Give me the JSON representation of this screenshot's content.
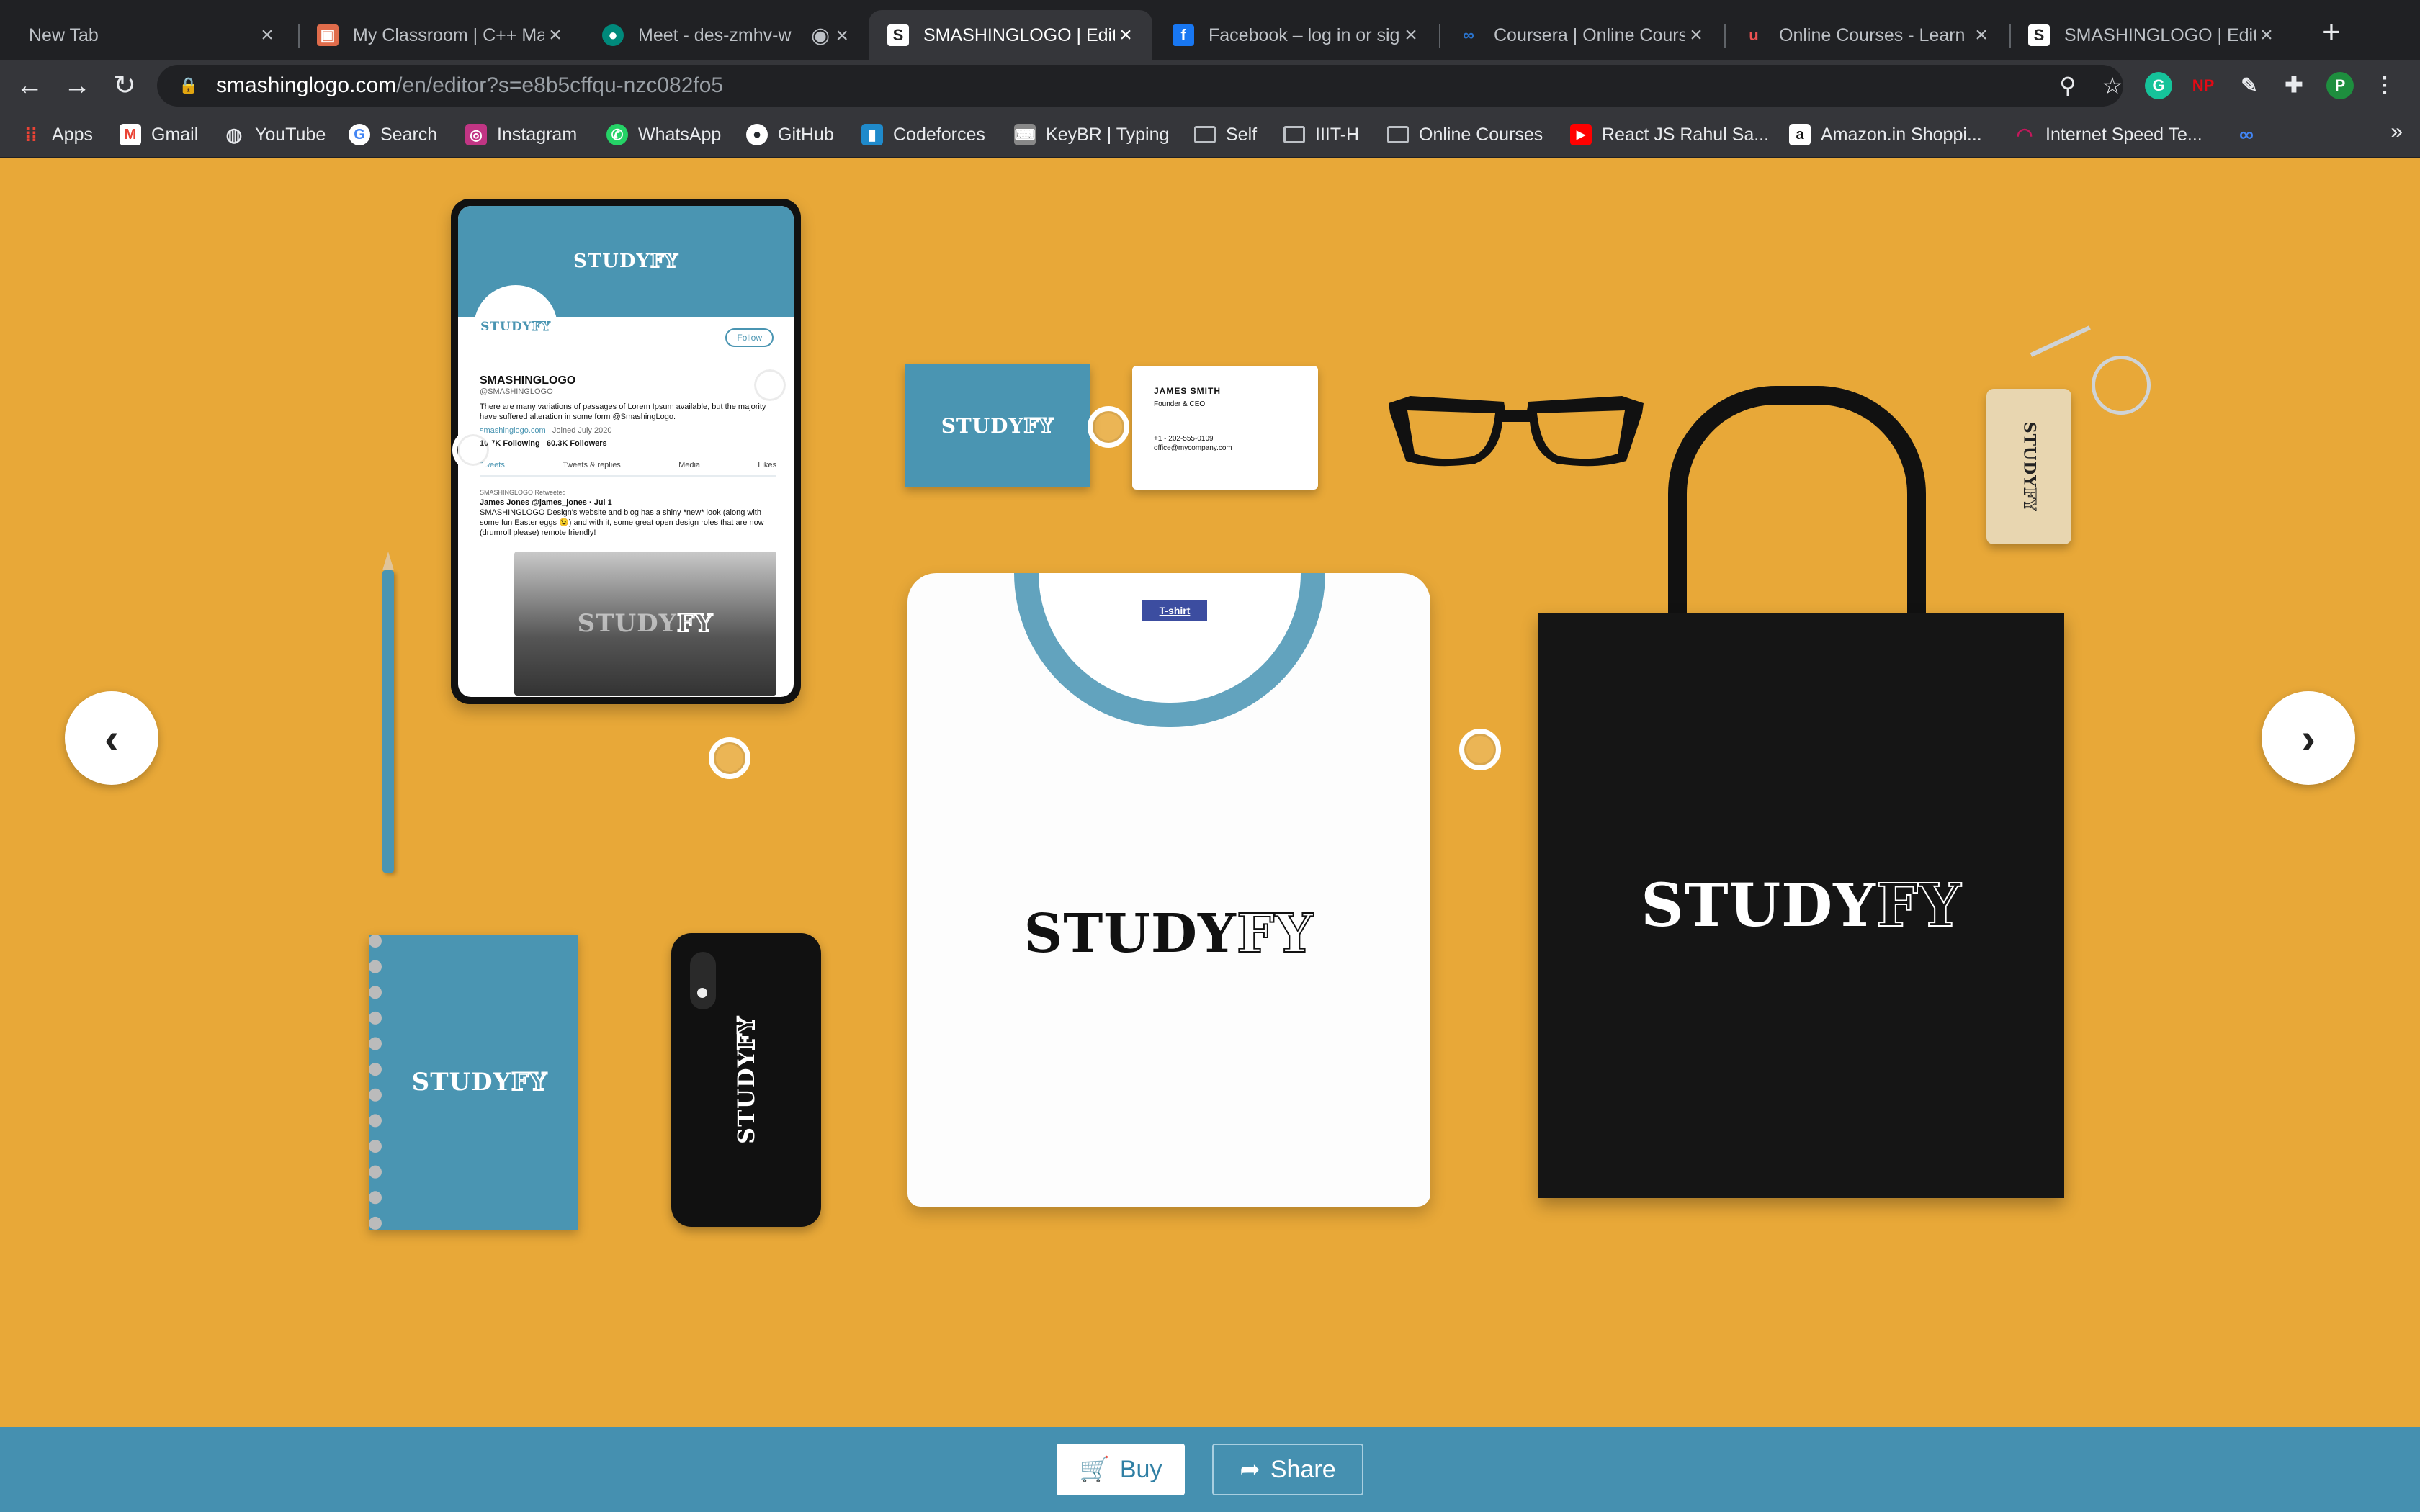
{
  "browser": {
    "tabs": [
      {
        "title": "New Tab",
        "active": false
      },
      {
        "title": "My Classroom | C++ Ma",
        "active": false
      },
      {
        "title": "Meet - des-zmhv-w",
        "active": false
      },
      {
        "title": "SMASHINGLOGO | Edito",
        "active": true
      },
      {
        "title": "Facebook – log in or sig",
        "active": false
      },
      {
        "title": "Coursera | Online Cours",
        "active": false
      },
      {
        "title": "Online Courses - Learn",
        "active": false
      },
      {
        "title": "SMASHINGLOGO | Edito",
        "active": false
      }
    ],
    "url_host": "smashinglogo.com",
    "url_path": "/en/editor?s=e8b5cffqu-nzc082fo5",
    "profile_initial": "P",
    "extensions": [
      {
        "name": "grammarly-icon",
        "label": "G",
        "color": "#15c39a"
      },
      {
        "name": "netflix-party-icon",
        "label": "NP",
        "color": "#e50914"
      }
    ],
    "bookmarks": [
      {
        "label": "Apps",
        "icon": "apps-grid-icon",
        "color": "#ea4335"
      },
      {
        "label": "Gmail",
        "icon": "gmail-icon",
        "color": "#ea4335"
      },
      {
        "label": "YouTube",
        "icon": "globe-icon",
        "color": "#5f6368"
      },
      {
        "label": "Search",
        "icon": "google-icon",
        "color": "#4285f4"
      },
      {
        "label": "Instagram",
        "icon": "instagram-icon",
        "color": "#c13584"
      },
      {
        "label": "WhatsApp",
        "icon": "whatsapp-icon",
        "color": "#25d366"
      },
      {
        "label": "GitHub",
        "icon": "github-icon",
        "color": "#24292e"
      },
      {
        "label": "Codeforces",
        "icon": "codeforces-icon",
        "color": "#1f8acb"
      },
      {
        "label": "KeyBR | Typing",
        "icon": "keybr-icon",
        "color": "#888888"
      },
      {
        "label": "Self",
        "icon": "folder-icon",
        "color": "folder"
      },
      {
        "label": "IIIT-H",
        "icon": "folder-icon",
        "color": "folder"
      },
      {
        "label": "Online Courses",
        "icon": "folder-icon",
        "color": "folder"
      },
      {
        "label": "React JS Rahul Sa...",
        "icon": "youtube-icon",
        "color": "#ff0000"
      },
      {
        "label": "Amazon.in Shoppi...",
        "icon": "amazon-icon",
        "color": "#111111"
      },
      {
        "label": "Internet Speed Te...",
        "icon": "speedtest-icon",
        "color": "#c2185b"
      }
    ]
  },
  "mockups": {
    "brand_main": "STUDY",
    "brand_outline": "FY",
    "tshirt_tag": "T-shirt",
    "business_card": {
      "name": "JAMES SMITH",
      "role": "Founder & CEO",
      "phone": "+1 - 202-555-0109",
      "email": "office@mycompany.com"
    },
    "twitter": {
      "avatar_text": "STUDYFY",
      "name": "SMASHINGLOGO",
      "handle": "@SMASHINGLOGO",
      "follow": "Follow",
      "bio": "There are many variations of passages of Lorem Ipsum available, but the majority have suffered alteration in some form @SmashingLogo.",
      "website": "smashinglogo.com",
      "joined": "Joined July 2020",
      "following": "10.7K Following",
      "followers": "60.3K Followers",
      "tabs": [
        "Tweets",
        "Tweets & replies",
        "Media",
        "Likes"
      ],
      "retweet_note": "SMASHINGLOGO Retweeted",
      "post_author": "James Jones @james_jones · Jul 1",
      "post_text": "SMASHINGLOGO Design's website and blog has a shiny *new* look (along with some fun Easter eggs 😉) and with it, some great open design roles that are now (drumroll please) remote friendly!"
    }
  },
  "actions": {
    "buy": "Buy",
    "share": "Share"
  }
}
